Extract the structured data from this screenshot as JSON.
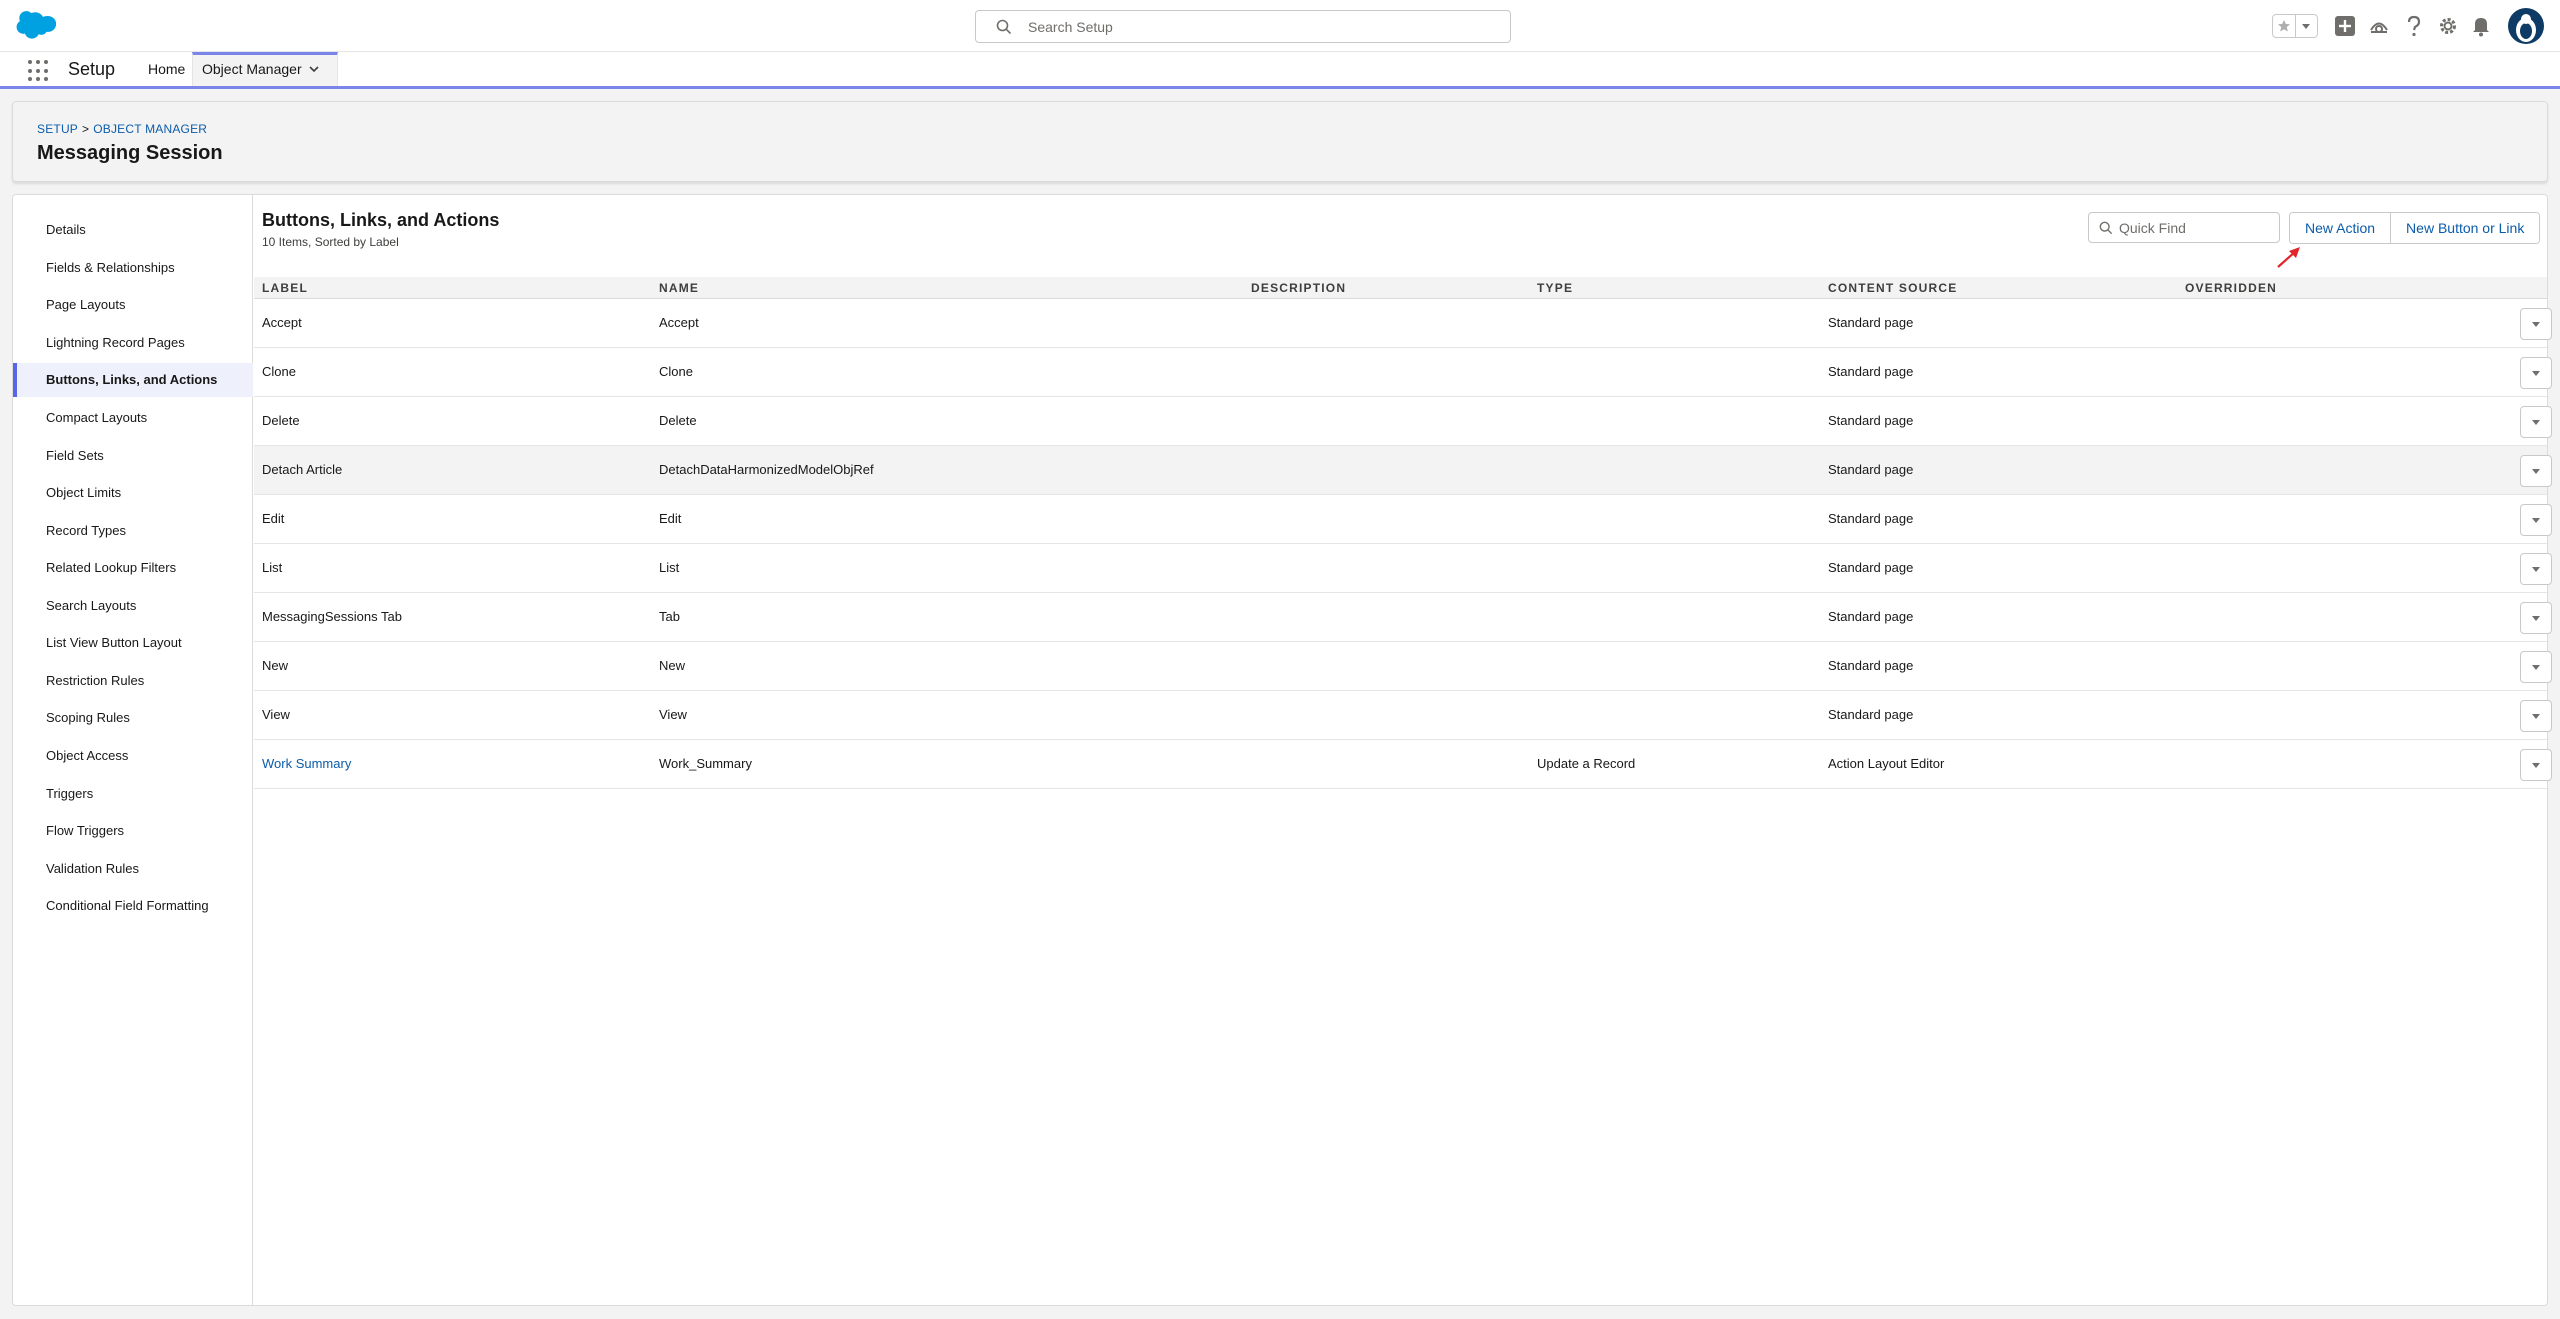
{
  "header": {
    "search_placeholder": "Search Setup"
  },
  "nav": {
    "app_name": "Setup",
    "tabs": [
      {
        "label": "Home"
      },
      {
        "label": "Object Manager"
      }
    ]
  },
  "page": {
    "breadcrumb": [
      "SETUP",
      "OBJECT MANAGER"
    ],
    "breadcrumb_sep": ">",
    "title": "Messaging Session"
  },
  "sidebar": {
    "items": [
      {
        "label": "Details"
      },
      {
        "label": "Fields & Relationships"
      },
      {
        "label": "Page Layouts"
      },
      {
        "label": "Lightning Record Pages"
      },
      {
        "label": "Buttons, Links, and Actions"
      },
      {
        "label": "Compact Layouts"
      },
      {
        "label": "Field Sets"
      },
      {
        "label": "Object Limits"
      },
      {
        "label": "Record Types"
      },
      {
        "label": "Related Lookup Filters"
      },
      {
        "label": "Search Layouts"
      },
      {
        "label": "List View Button Layout"
      },
      {
        "label": "Restriction Rules"
      },
      {
        "label": "Scoping Rules"
      },
      {
        "label": "Object Access"
      },
      {
        "label": "Triggers"
      },
      {
        "label": "Flow Triggers"
      },
      {
        "label": "Validation Rules"
      },
      {
        "label": "Conditional Field Formatting"
      }
    ],
    "active": "Buttons, Links, and Actions"
  },
  "content": {
    "title": "Buttons, Links, and Actions",
    "subtitle": "10 Items, Sorted by Label",
    "quick_find_placeholder": "Quick Find",
    "new_action_label": "New Action",
    "new_button_label": "New Button or Link",
    "columns": [
      "LABEL",
      "NAME",
      "DESCRIPTION",
      "TYPE",
      "CONTENT SOURCE",
      "OVERRIDDEN"
    ],
    "rows": [
      {
        "label": "Accept",
        "name": "Accept",
        "description": "",
        "type": "",
        "content_source": "Standard page",
        "overridden": ""
      },
      {
        "label": "Clone",
        "name": "Clone",
        "description": "",
        "type": "",
        "content_source": "Standard page",
        "overridden": ""
      },
      {
        "label": "Delete",
        "name": "Delete",
        "description": "",
        "type": "",
        "content_source": "Standard page",
        "overridden": ""
      },
      {
        "label": "Detach Article",
        "name": "DetachDataHarmonizedModelObjRef",
        "description": "",
        "type": "",
        "content_source": "Standard page",
        "overridden": ""
      },
      {
        "label": "Edit",
        "name": "Edit",
        "description": "",
        "type": "",
        "content_source": "Standard page",
        "overridden": ""
      },
      {
        "label": "List",
        "name": "List",
        "description": "",
        "type": "",
        "content_source": "Standard page",
        "overridden": ""
      },
      {
        "label": "MessagingSessions Tab",
        "name": "Tab",
        "description": "",
        "type": "",
        "content_source": "Standard page",
        "overridden": ""
      },
      {
        "label": "New",
        "name": "New",
        "description": "",
        "type": "",
        "content_source": "Standard page",
        "overridden": ""
      },
      {
        "label": "View",
        "name": "View",
        "description": "",
        "type": "",
        "content_source": "Standard page",
        "overridden": ""
      },
      {
        "label": "Work Summary",
        "name": "Work_Summary",
        "description": "",
        "type": "Update a Record",
        "content_source": "Action Layout Editor",
        "overridden": ""
      }
    ]
  },
  "colors": {
    "brand_blue": "#0b5cab",
    "salesforce_cloud": "#00a1e0",
    "nav_accent": "#7b84e8",
    "annotation_arrow": "#e0262b"
  },
  "icons": [
    "salesforce-logo",
    "search-icon",
    "star-icon",
    "chevron-down-icon",
    "add-icon",
    "trailhead-icon",
    "help-icon",
    "gear-icon",
    "bell-icon",
    "avatar",
    "app-launcher-icon"
  ]
}
